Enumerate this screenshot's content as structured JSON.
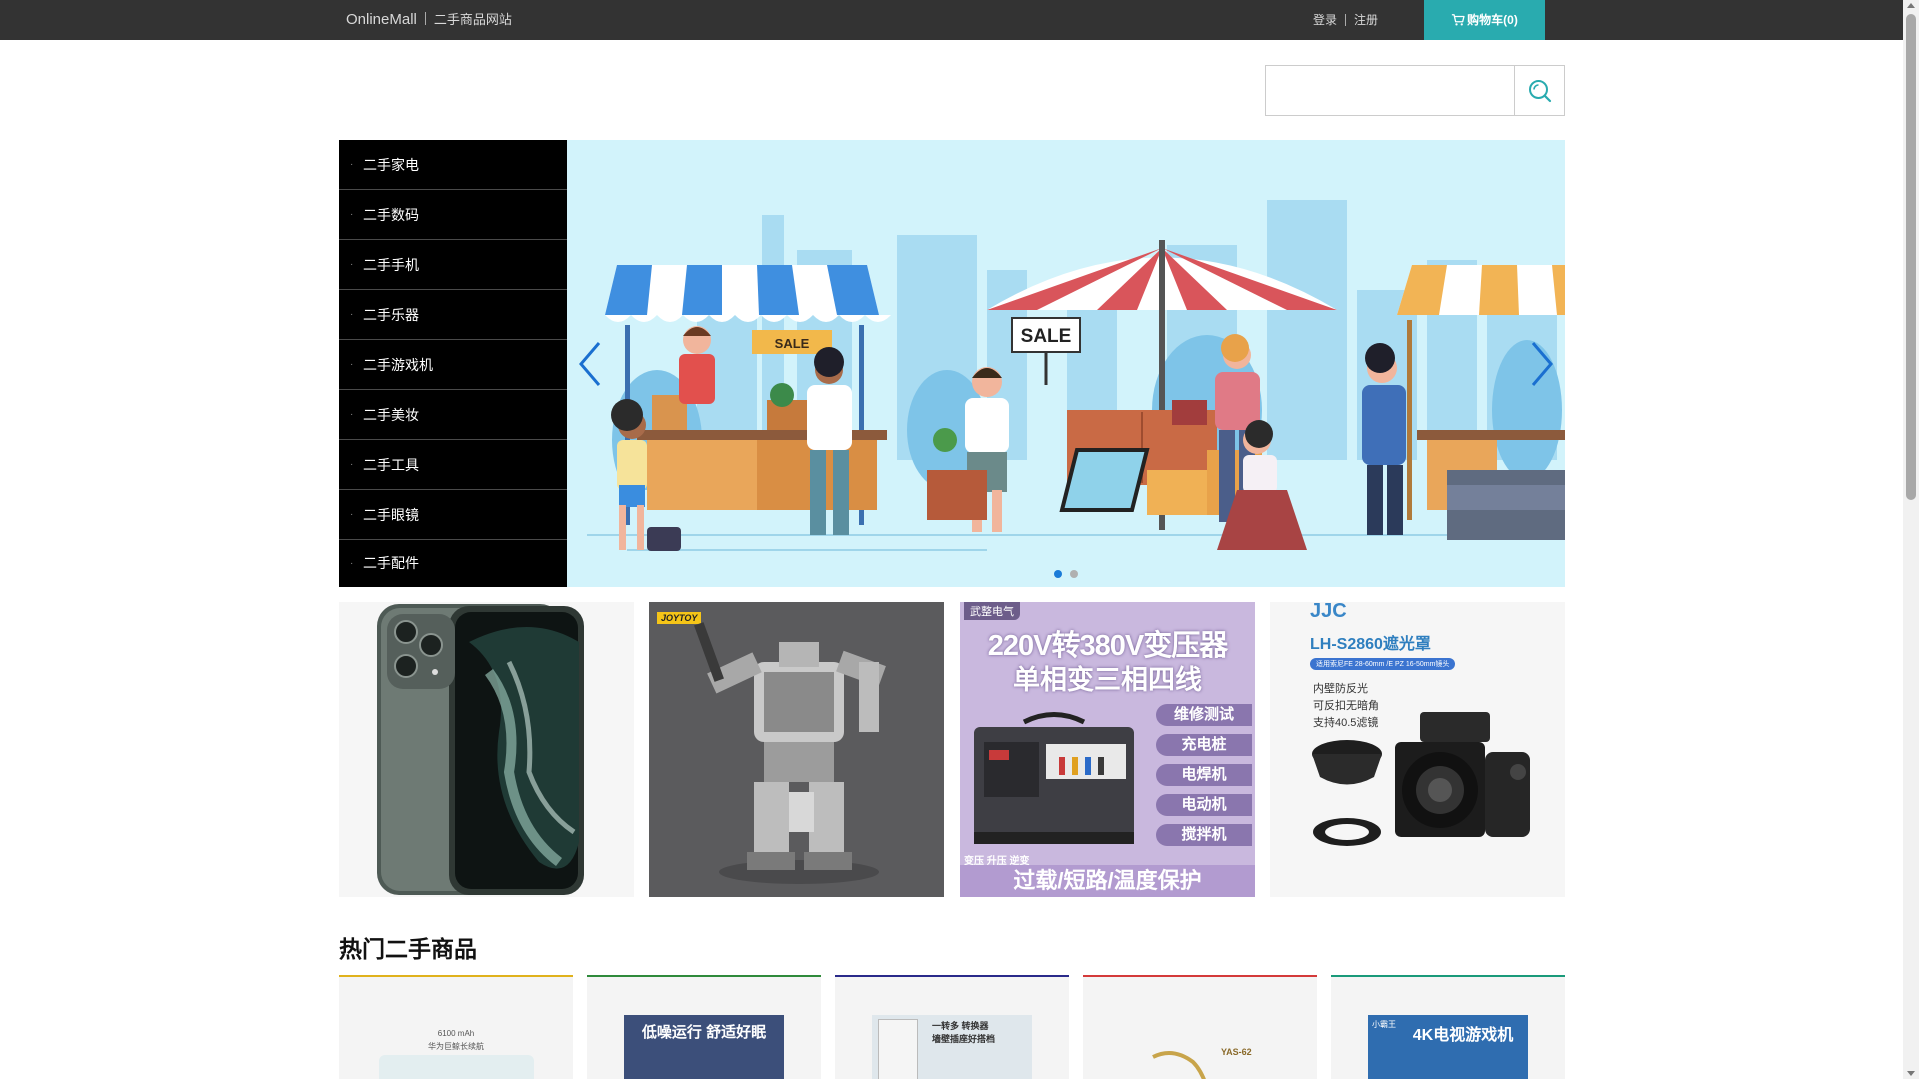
{
  "header": {
    "brand": "OnlineMall",
    "subtitle": "二手商品网站",
    "login": "登录",
    "register": "注册",
    "cart_label": "购物车(0)",
    "cart_color": "#29abaf"
  },
  "search": {
    "placeholder": "",
    "value": "",
    "icon": "search-icon"
  },
  "categories": [
    {
      "label": "二手家电"
    },
    {
      "label": "二手数码"
    },
    {
      "label": "二手手机"
    },
    {
      "label": "二手乐器"
    },
    {
      "label": "二手游戏机"
    },
    {
      "label": "二手美妆"
    },
    {
      "label": "二手工具"
    },
    {
      "label": "二手眼镜"
    },
    {
      "label": "二手配件"
    }
  ],
  "banner": {
    "sign_left": "SALE",
    "sign_right": "SALE",
    "active_slide": 1,
    "slide_count": 2
  },
  "promos": {
    "p2_brand": "JOYTOY",
    "p3_brand": "武整电气",
    "p3_title1": "220V转380V变压器",
    "p3_title2": "单相变三相四线",
    "p3_tags": [
      "维修测试",
      "充电桩",
      "电焊机",
      "电动机",
      "搅拌机"
    ],
    "p3_bottom_small": "变压 升压 逆变",
    "p3_bottom": "过载/短路/温度保护",
    "p4_brand": "JJC",
    "p4_model": "LH-S2860遮光罩",
    "p4_compat": "适用索尼FE 28-60mm /E PZ 16-50mm镜头",
    "p4_features": [
      "内壁防反光",
      "可反扣无暗角",
      "支持40.5滤镜"
    ]
  },
  "hot": {
    "title": "热门二手商品",
    "items": [
      {
        "line_color": "#e0b21c",
        "text1": "6100 mAh",
        "text2": "华为巨鲸长续航"
      },
      {
        "line_color": "#2f8a3b",
        "text1": "低噪运行 舒适好眠"
      },
      {
        "line_color": "#2a2a8a",
        "text1": "一转多 转换器",
        "text2": "墙壁插座好搭档"
      },
      {
        "line_color": "#d43a3a",
        "text1": "YAS-62"
      },
      {
        "line_color": "#1a9a7a",
        "text1": "4K电视游戏机",
        "text2": "小霸王"
      }
    ]
  }
}
